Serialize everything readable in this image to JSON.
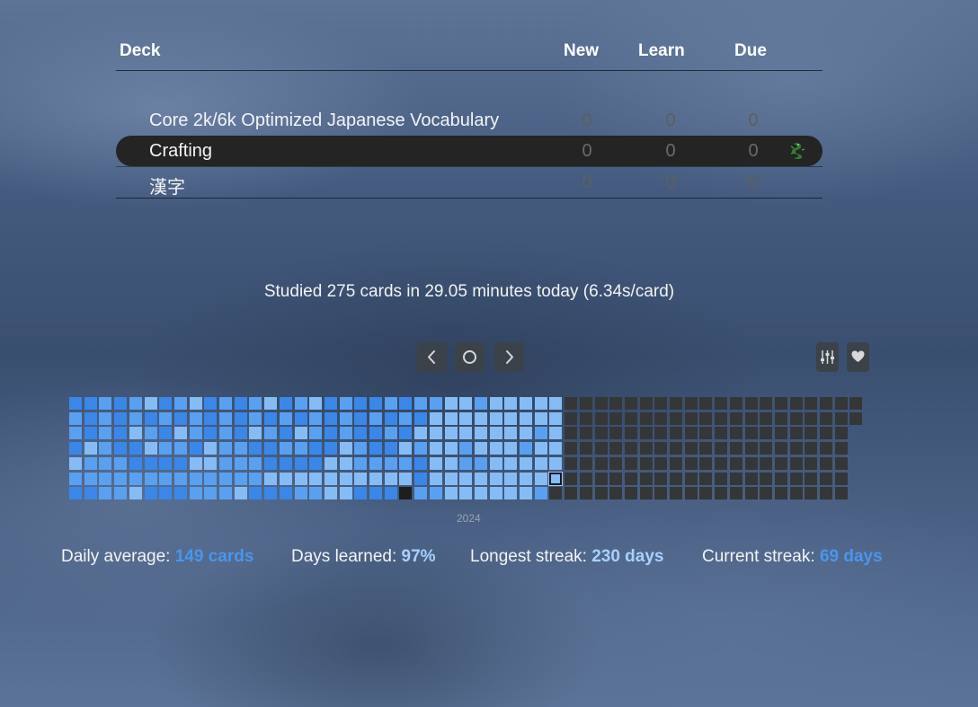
{
  "deck_table": {
    "headers": {
      "deck": "Deck",
      "new": "New",
      "learn": "Learn",
      "due": "Due"
    },
    "rows": [
      {
        "name": "Core 2k/6k Optimized Japanese Vocabulary",
        "new": "0",
        "learn": "0",
        "due": "0",
        "current": false
      },
      {
        "name": "Crafting",
        "new": "0",
        "learn": "0",
        "due": "0",
        "current": true,
        "icon": "dragon-icon"
      },
      {
        "name": "漢字",
        "new": "0",
        "learn": "0",
        "due": "0",
        "current": false
      }
    ]
  },
  "studied_today": "Studied 275 cards in 29.05 minutes today (6.34s/card)",
  "heatmap": {
    "year": "2024",
    "controls": [
      "chevron-left-icon",
      "circle-icon",
      "chevron-right-icon",
      "sliders-icon",
      "heart-icon"
    ],
    "colors": {
      "high": "#3a87e8",
      "mid": "#5aa0f0",
      "low": "#86bcf5",
      "empty": "#343638",
      "today_marker": "#1e1e1e"
    }
  },
  "summary": {
    "daily_average_label": "Daily average:",
    "daily_average_value": "149 cards",
    "days_learned_label": "Days learned:",
    "days_learned_value": "97%",
    "longest_streak_label": "Longest streak:",
    "longest_streak_value": "230 days",
    "current_streak_label": "Current streak:",
    "current_streak_value": "69 days",
    "colors": {
      "daily_average": "#4a96ec",
      "days_learned": "#a8d0ff",
      "longest_streak": "#a8d0ff",
      "current_streak": "#4a96ec"
    }
  }
}
